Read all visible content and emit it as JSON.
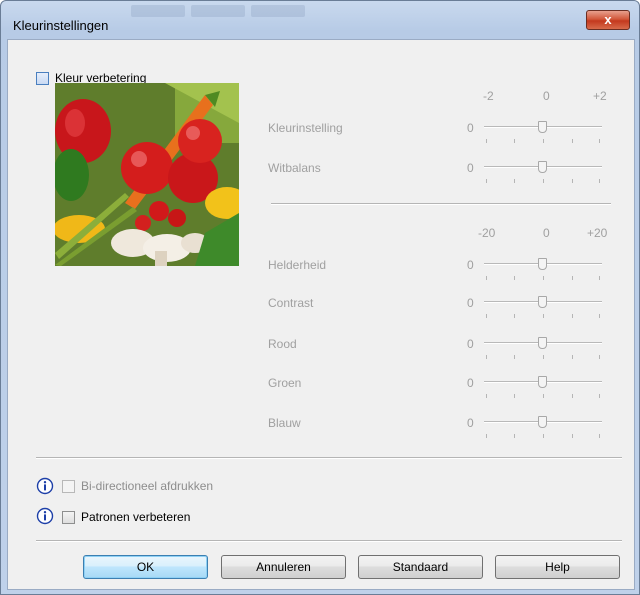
{
  "window": {
    "title": "Kleurinstellingen",
    "close_glyph": "x"
  },
  "color_enhance": {
    "label": "Kleur verbetering",
    "checked": false
  },
  "image": {
    "icon": "vegetables-preview-image"
  },
  "scale_top": {
    "min": "-2",
    "mid": "0",
    "max": "+2"
  },
  "scale_bottom": {
    "min": "-20",
    "mid": "0",
    "max": "+20"
  },
  "sliders_top": [
    {
      "label": "Kleurinstelling",
      "value": "0"
    },
    {
      "label": "Witbalans",
      "value": "0"
    }
  ],
  "sliders_bottom": [
    {
      "label": "Helderheid",
      "value": "0"
    },
    {
      "label": "Contrast",
      "value": "0"
    },
    {
      "label": "Rood",
      "value": "0"
    },
    {
      "label": "Groen",
      "value": "0"
    },
    {
      "label": "Blauw",
      "value": "0"
    }
  ],
  "options": {
    "bidirectional": {
      "label": "Bi-directioneel afdrukken",
      "checked": false,
      "disabled": true
    },
    "improve_pattern": {
      "label": "Patronen verbeteren",
      "checked": false,
      "disabled": false
    }
  },
  "buttons": {
    "ok": "OK",
    "cancel": "Annuleren",
    "default": "Standaard",
    "help": "Help"
  },
  "colors": {
    "accent": "#3c7fb1",
    "disabled_text": "#a0a0a0",
    "close_red": "#c4391e"
  }
}
